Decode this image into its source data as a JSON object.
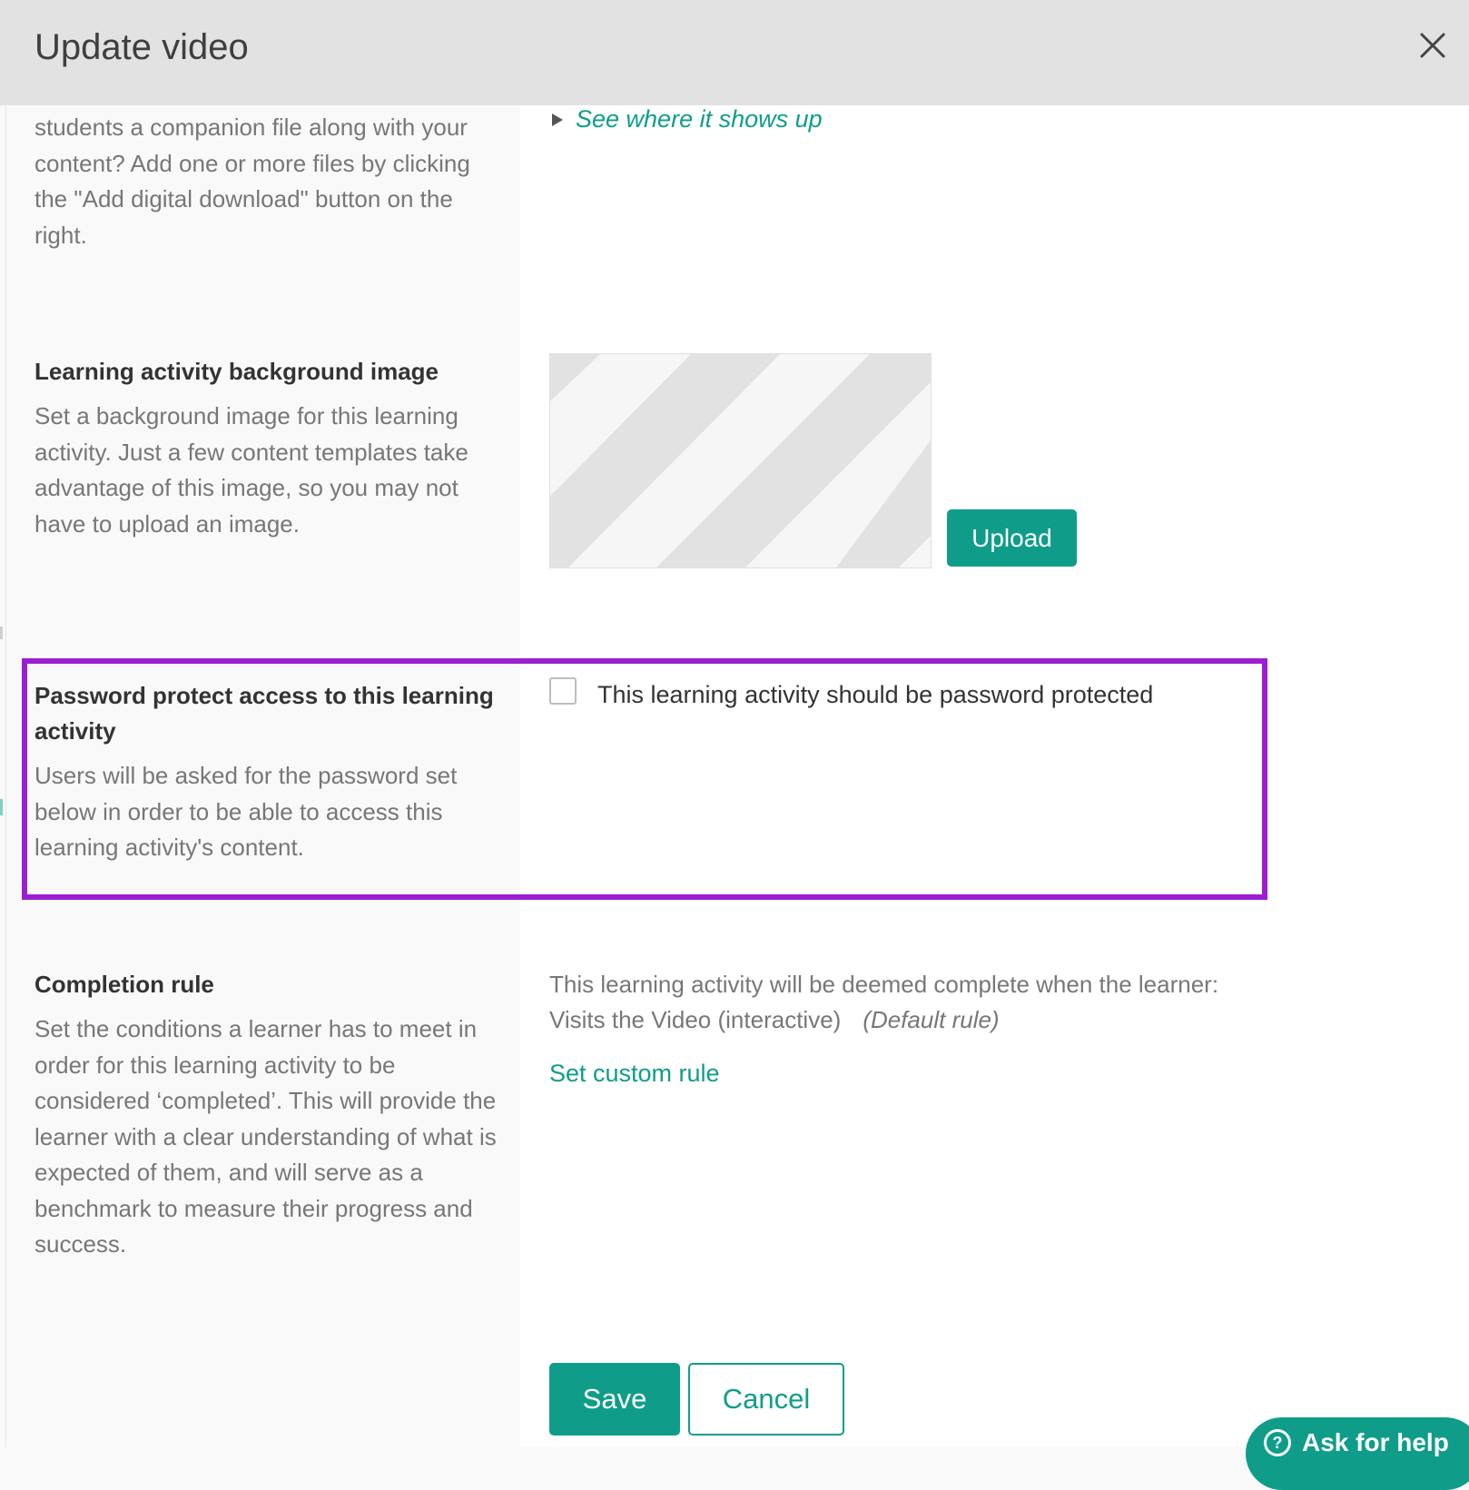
{
  "modal": {
    "title": "Update video"
  },
  "digital_download": {
    "description": "students a companion file along with your content? Add one or more files by clicking the \"Add digital download\" button on the right.",
    "see_where_link": "See where it shows up"
  },
  "background_image": {
    "title": "Learning activity background image",
    "description": "Set a background image for this learning activity. Just a few content templates take advantage of this image, so you may not have to upload an image.",
    "upload_label": "Upload"
  },
  "password": {
    "title": "Password protect access to this learning activity",
    "description": "Users will be asked for the password set below in order to be able to access this learning activity's content.",
    "checkbox_label": "This learning activity should be password protected",
    "checked": false
  },
  "completion_rule": {
    "title": "Completion rule",
    "description": "Set the conditions a learner has to meet in order for this learning activity to be considered ‘completed’. This will provide the learner with a clear understanding of what is expected of them, and will serve as a benchmark to measure their progress and success.",
    "intro": "This learning activity will be deemed complete when the learner:",
    "current_rule": "Visits the Video (interactive)",
    "rule_note": "(Default rule)",
    "custom_link": "Set custom rule"
  },
  "footer": {
    "save_label": "Save",
    "cancel_label": "Cancel"
  },
  "help": {
    "icon_glyph": "?",
    "label": "Ask for help"
  },
  "colors": {
    "accent": "#0f9d8a",
    "highlight": "#9b1fd1",
    "header_bg": "#e2e2e2",
    "label_bg": "#f9f9f9"
  }
}
